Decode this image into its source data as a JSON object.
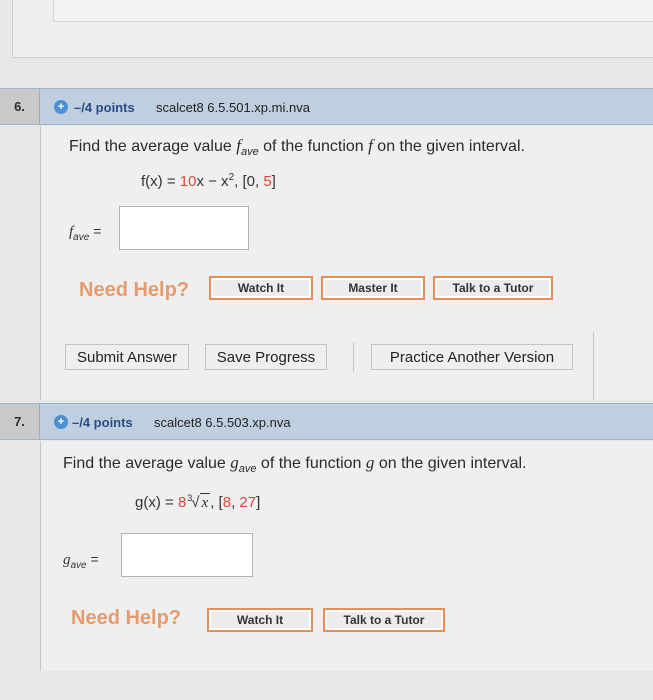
{
  "questions": [
    {
      "number": "6.",
      "points": "–/4 points",
      "problem_id": "scalcet8 6.5.501.xp.mi.nva",
      "prompt_pre": "Find the average value ",
      "prompt_var": "f",
      "prompt_sub": "ave",
      "prompt_mid": " of the function ",
      "prompt_func": "f",
      "prompt_post": " on the given interval.",
      "formula_lhs": "f(x) = ",
      "formula_coef": "10",
      "formula_rest": "x − x",
      "formula_exp": "2",
      "formula_sep": ",    [0, ",
      "formula_end": "5",
      "formula_close": "]",
      "answer_var": "f",
      "answer_sub": "ave",
      "answer_eq": " =",
      "answer_value": "",
      "need_help": "Need Help?",
      "help_buttons": [
        "Watch It",
        "Master It",
        "Talk to a Tutor"
      ],
      "actions": [
        "Submit Answer",
        "Save Progress",
        "Practice Another Version"
      ]
    },
    {
      "number": "7.",
      "points": "–/4 points",
      "problem_id": "scalcet8 6.5.503.xp.nva",
      "prompt_pre": "Find the average value ",
      "prompt_var": "g",
      "prompt_sub": "ave",
      "prompt_mid": " of the function ",
      "prompt_func": "g",
      "prompt_post": " on the given interval.",
      "formula_lhs": "g(x) = ",
      "formula_coef": "8",
      "formula_root_index": "3",
      "formula_radicand": "x",
      "formula_sep": ",    [",
      "formula_a": "8",
      "formula_comma": ", ",
      "formula_b": "27",
      "formula_close": "]",
      "answer_var": "g",
      "answer_sub": "ave",
      "answer_eq": " =",
      "answer_value": "",
      "need_help": "Need Help?",
      "help_buttons": [
        "Watch It",
        "Talk to a Tutor"
      ]
    }
  ],
  "colors": {
    "header_bg": "#bfcfe0",
    "points_text": "#2a4d86",
    "need_help": "#e79a6b",
    "help_border": "#e48f5a",
    "red_value": "#d44a3a"
  }
}
